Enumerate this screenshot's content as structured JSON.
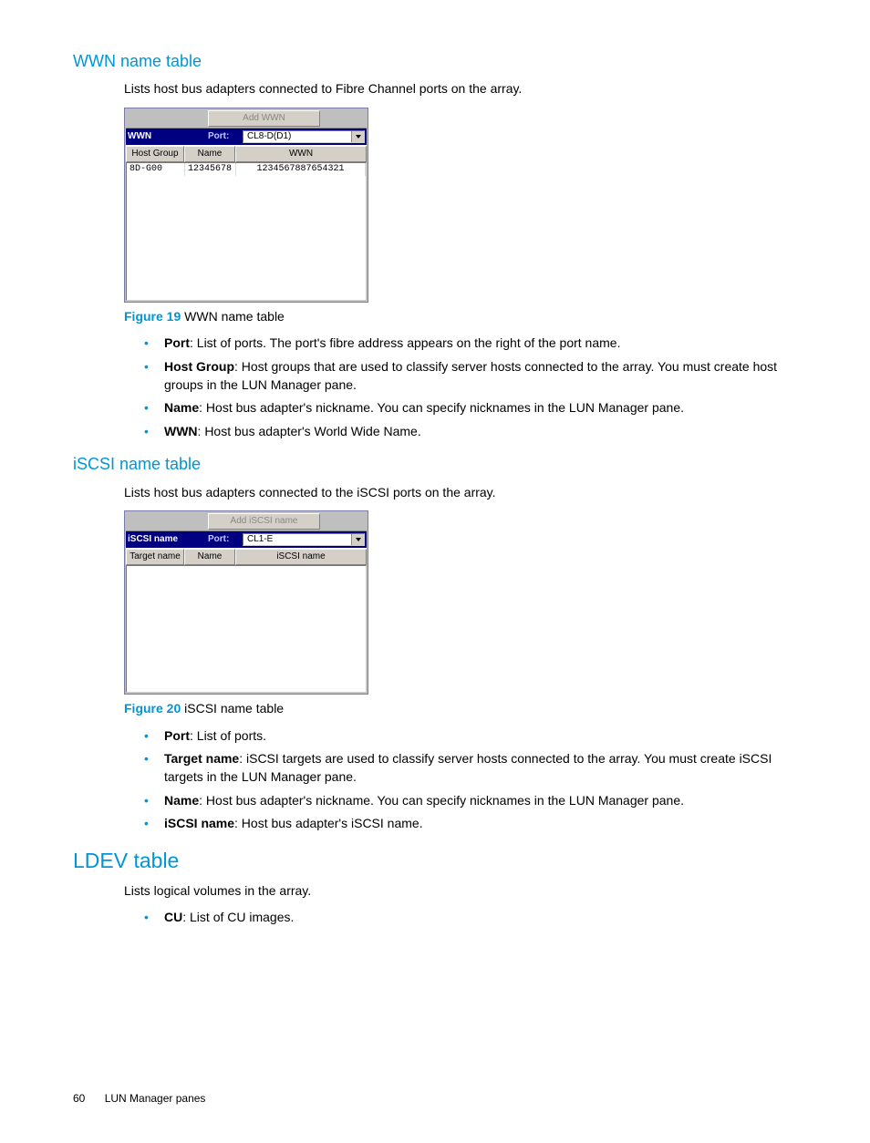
{
  "sections": {
    "wwn": {
      "title": "WWN name table",
      "intro": "Lists host bus adapters connected to Fibre Channel ports on the array.",
      "figure": {
        "num": "Figure 19",
        "caption": "WWN name table"
      },
      "panel": {
        "topButton": "Add WWN",
        "headerLabel": "WWN",
        "portLabel": "Port:",
        "portValue": "CL8-D(D1)",
        "cols": {
          "a": "Host Group",
          "b": "Name",
          "c": "WWN"
        },
        "row": {
          "a": "8D-G00",
          "b": "12345678",
          "c": "1234567887654321"
        }
      },
      "bullets": [
        {
          "term": "Port",
          "text": ": List of ports. The port's fibre address appears on the right of the port name."
        },
        {
          "term": "Host Group",
          "text": ": Host groups that are used to classify server hosts connected to the array. You must create host groups in the LUN Manager pane."
        },
        {
          "term": "Name",
          "text": ": Host bus adapter's nickname. You can specify nicknames in the LUN Manager pane."
        },
        {
          "term": "WWN",
          "text": ": Host bus adapter's World Wide Name."
        }
      ]
    },
    "iscsi": {
      "title": "iSCSI name table",
      "intro": "Lists host bus adapters connected to the iSCSI ports on the array.",
      "figure": {
        "num": "Figure 20",
        "caption": "iSCSI name table"
      },
      "panel": {
        "topButton": "Add iSCSI name",
        "headerLabel": "iSCSI name",
        "portLabel": "Port:",
        "portValue": "CL1-E",
        "cols": {
          "a": "Target name",
          "b": "Name",
          "c": "iSCSI name"
        }
      },
      "bullets": [
        {
          "term": "Port",
          "text": ": List of ports."
        },
        {
          "term": "Target name",
          "text": ": iSCSI targets are used to classify server hosts connected to the array. You must create iSCSI targets in the LUN Manager pane."
        },
        {
          "term": "Name",
          "text": ": Host bus adapter's nickname. You can specify nicknames in the LUN Manager pane."
        },
        {
          "term": "iSCSI name",
          "text": ": Host bus adapter's iSCSI name."
        }
      ]
    },
    "ldev": {
      "title": "LDEV table",
      "intro": "Lists logical volumes in the array.",
      "bullets": [
        {
          "term": "CU",
          "text": ": List of CU images."
        }
      ]
    }
  },
  "footer": {
    "page": "60",
    "section": "LUN Manager panes"
  }
}
